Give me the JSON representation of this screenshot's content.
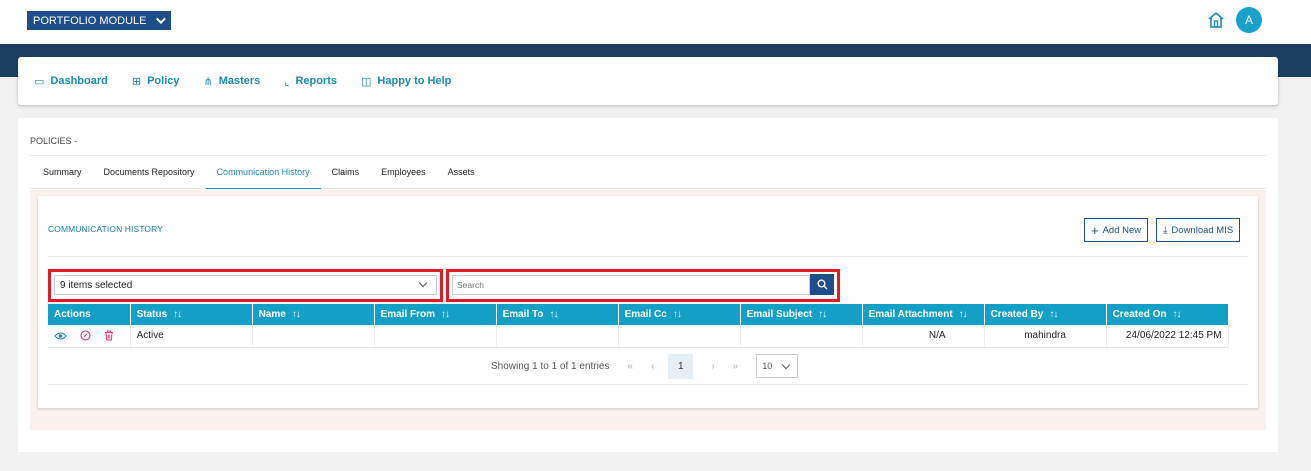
{
  "header": {
    "module_label": "PORTFOLIO MODULE",
    "avatar_letter": "A"
  },
  "nav": {
    "items": [
      {
        "label": "Dashboard",
        "icon": "monitor-icon"
      },
      {
        "label": "Policy",
        "icon": "grid-icon"
      },
      {
        "label": "Masters",
        "icon": "hierarchy-icon"
      },
      {
        "label": "Reports",
        "icon": "chart-icon"
      },
      {
        "label": "Happy to Help",
        "icon": "book-icon"
      }
    ]
  },
  "page": {
    "section_label": "POLICIES -",
    "tabs": [
      "Summary",
      "Documents Repository",
      "Communication History",
      "Claims",
      "Employees",
      "Assets"
    ],
    "active_tab": "Communication History"
  },
  "panel": {
    "title": "COMMUNICATION HISTORY",
    "add_new_label": "Add New",
    "download_label": "Download MIS",
    "select_value": "9 items selected",
    "search_placeholder": "Search"
  },
  "table": {
    "columns": [
      "Actions",
      "Status",
      "Name",
      "Email From",
      "Email To",
      "Email Cc",
      "Email Subject",
      "Email Attachment",
      "Created By",
      "Created On"
    ],
    "rows": [
      {
        "status": "Active",
        "name": "",
        "email_from": "",
        "email_to": "",
        "email_cc": "",
        "email_subject": "",
        "email_attachment": "N/A",
        "created_by": "mahindra",
        "created_on": "24/06/2022 12:45 PM"
      }
    ]
  },
  "pager": {
    "info": "Showing 1 to 1 of 1 entries",
    "current_page": "1",
    "page_size": "10",
    "first": "«",
    "prev": "‹",
    "next": "›",
    "last": "»"
  },
  "colors": {
    "brand_navy": "#1d4e8a",
    "accent_teal": "#14a0c6",
    "highlight_red": "#e01b22"
  }
}
